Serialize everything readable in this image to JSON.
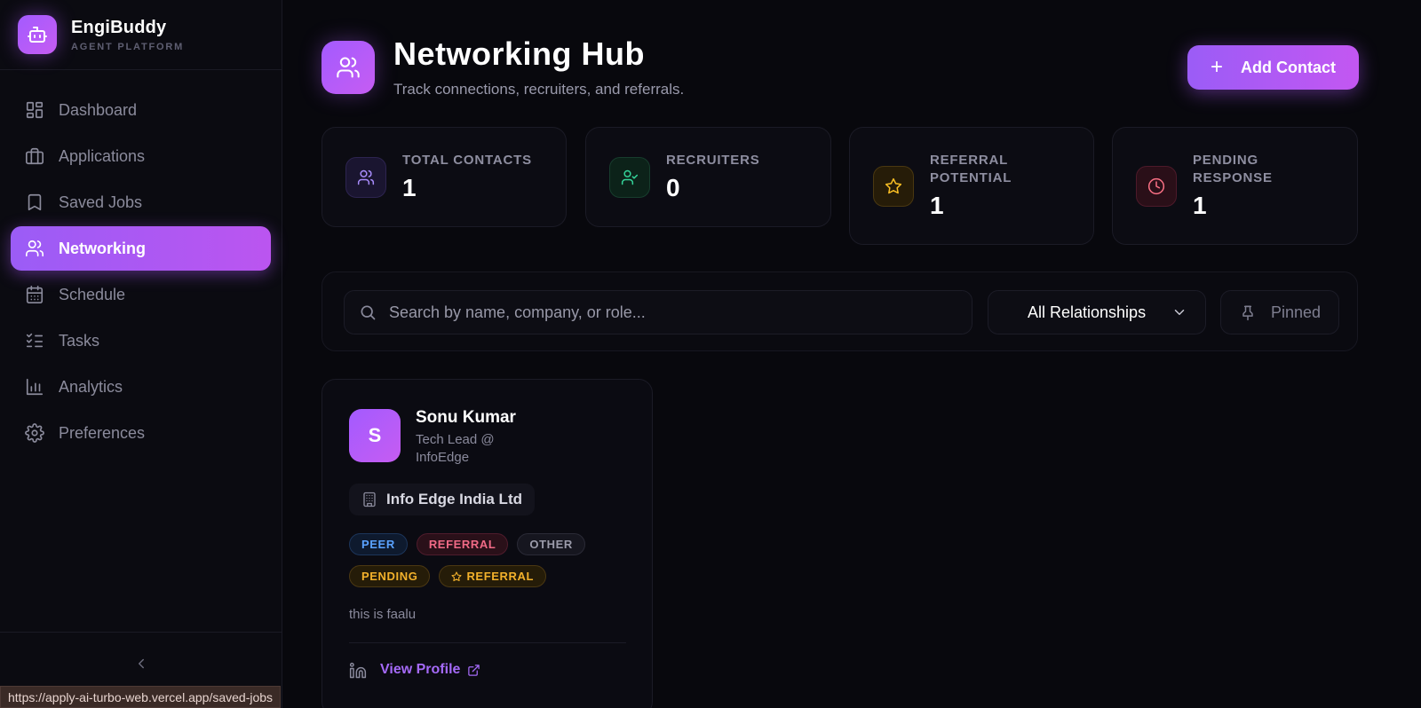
{
  "brand": {
    "name": "EngiBuddy",
    "subtitle": "AGENT PLATFORM"
  },
  "sidebar": {
    "items": [
      {
        "label": "Dashboard",
        "icon": "layout-grid-icon"
      },
      {
        "label": "Applications",
        "icon": "briefcase-icon"
      },
      {
        "label": "Saved Jobs",
        "icon": "bookmark-icon"
      },
      {
        "label": "Networking",
        "icon": "users-icon",
        "active": true
      },
      {
        "label": "Schedule",
        "icon": "calendar-icon"
      },
      {
        "label": "Tasks",
        "icon": "list-checks-icon"
      },
      {
        "label": "Analytics",
        "icon": "bar-chart-icon"
      },
      {
        "label": "Preferences",
        "icon": "gear-icon"
      }
    ],
    "collapse_icon": "chevron-left-icon"
  },
  "status_bar": {
    "url": "https://apply-ai-turbo-web.vercel.app/saved-jobs"
  },
  "header": {
    "title": "Networking Hub",
    "subtitle": "Track connections, recruiters, and referrals.",
    "add_button": "Add Contact"
  },
  "stats": [
    {
      "label": "TOTAL CONTACTS",
      "value": "1",
      "color": "#a78bfa"
    },
    {
      "label": "RECRUITERS",
      "value": "0",
      "color": "#34d399"
    },
    {
      "label": "REFERRAL POTENTIAL",
      "value": "1",
      "color": "#fbbf24"
    },
    {
      "label": "PENDING RESPONSE",
      "value": "1",
      "color": "#fb7185"
    }
  ],
  "filters": {
    "search_placeholder": "Search by name, company, or role...",
    "relationship": "All Relationships",
    "pinned": "Pinned"
  },
  "contact": {
    "initial": "S",
    "name": "Sonu Kumar",
    "role": "Tech Lead @ InfoEdge",
    "company": "Info Edge India Ltd",
    "tags": [
      "PEER",
      "REFERRAL",
      "OTHER",
      "PENDING",
      "REFERRAL"
    ],
    "notes": "this is faalu",
    "view_profile": "View Profile"
  },
  "colors": {
    "accent": "#a855f7",
    "background": "#08080d"
  }
}
